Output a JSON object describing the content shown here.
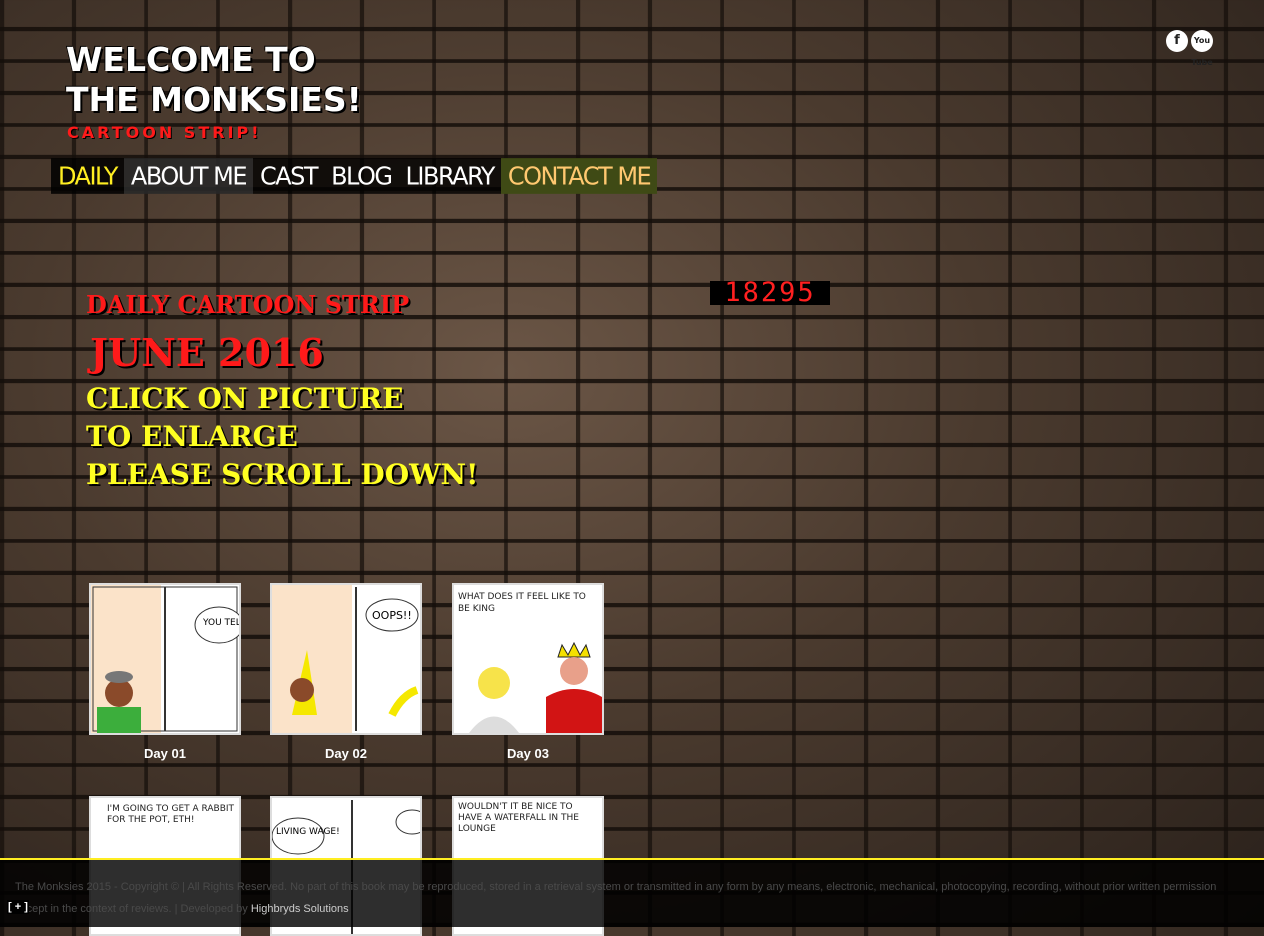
{
  "header": {
    "title_line1": "WELCOME TO",
    "title_line2": "THE MONKSIES!",
    "subtitle": "CARTOON STRIP!"
  },
  "social": {
    "facebook": "f",
    "youtube": "You Tube"
  },
  "nav": {
    "items": [
      {
        "label": "DAILY"
      },
      {
        "label": "ABOUT ME"
      },
      {
        "label": "CAST"
      },
      {
        "label": "BLOG"
      },
      {
        "label": "LIBRARY"
      },
      {
        "label": "CONTACT ME"
      }
    ]
  },
  "counter": "18295",
  "intro": {
    "line1": "DAILY CARTOON STRIP",
    "line2": "JUNE 2016",
    "line3": "CLICK ON PICTURE",
    "line4": "TO ENLARGE",
    "line5": "PLEASE SCROLL DOWN!"
  },
  "gallery": {
    "items": [
      {
        "label": "Day 01",
        "text": "YOU TELL"
      },
      {
        "label": "Day 02",
        "text": "OOPS!!"
      },
      {
        "label": "Day 03",
        "text": "WHAT DOES IT FEEL LIKE TO BE KING"
      },
      {
        "label": "",
        "text": "I'M GOING TO GET A RABBIT FOR THE POT, ETH!"
      },
      {
        "label": "",
        "text": "LIVING WAGE!"
      },
      {
        "label": "",
        "text": "WOULDN'T IT BE NICE TO HAVE A WATERFALL IN THE LOUNGE"
      }
    ]
  },
  "footer": {
    "copyright": "The Monksies 2015 - Copyright © | All Rights Reserved. No part of this book may be reproduced, stored in a retrieval system or transmitted in any form by any means, electronic, mechanical, photocopying, recording, without prior written permission except in the context of reviews. | Developed by",
    "developer": "Highbryds Solutions",
    "toggle": "[ + ]"
  },
  "colors": {
    "accent_yellow": "#ffee22",
    "accent_red": "#ff1a1a",
    "contact_bg": "#3f4a15"
  }
}
